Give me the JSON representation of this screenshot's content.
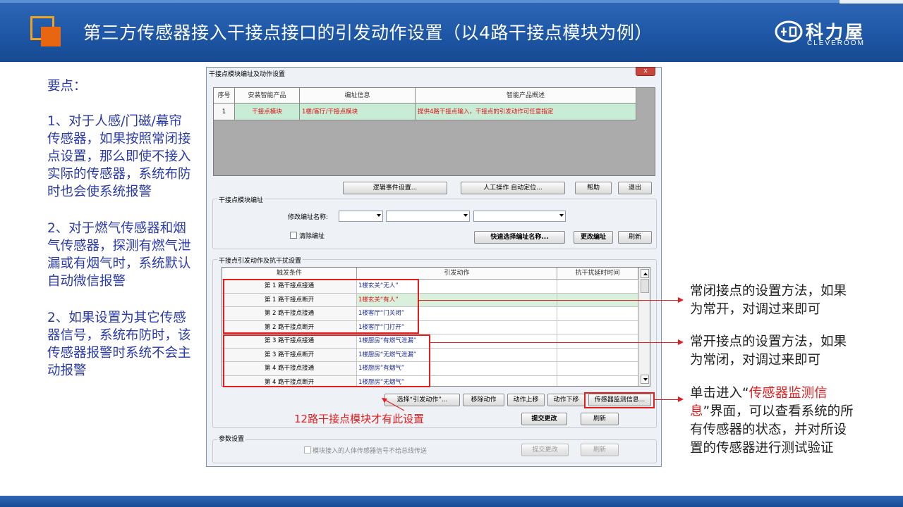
{
  "slide": {
    "title": "第三方传感器接入干接点接口的引发动作设置（以4路干接点模块为例）",
    "brand_cn": "科力屋",
    "brand_en": "CLEVEROOM",
    "colors": {
      "header_blue": "#1e57a6",
      "accent_orange": "#e8660f",
      "annotation_red": "#e21e1e",
      "note_blue": "#2a3aa8"
    }
  },
  "notes": {
    "heading": "要点：",
    "p1": "1、对于人感/门磁/幕帘传感器，如果按照常闭接点设置，那么即使不接入实际的传感器，系统布防时也会使系统报警",
    "p2": "2、对于燃气传感器和烟气传感器，探测有燃气泄漏或有烟气时，系统默认自动微信报警",
    "p3": "2、如果设置为其它传感器信号，系统布防时，该传感器报警时系统不会主动报警"
  },
  "dialog": {
    "title": "干接点模块编址及动作设置",
    "close_label": "x",
    "product_table": {
      "columns": [
        "序号",
        "安装智能产品",
        "编址信息",
        "智能产品概述"
      ],
      "rows": [
        [
          "1",
          "干接点模块",
          "1楼/客厅/干接点模块",
          "提供4路干接点输入，干接点的引发动作可任意指定"
        ]
      ]
    },
    "top_buttons": {
      "logic": "逻辑事件设置...",
      "manual": "人工操作  自动定位...",
      "help": "帮助",
      "exit": "退出"
    },
    "addr_section": {
      "label": "干接点模块编址",
      "rename_label": "修改编址名称:",
      "clear_label": "清除编址",
      "quick_select": "快速选择编址名称...",
      "change_addr": "更改编址",
      "refresh": "刷新"
    },
    "action_section": {
      "label": "干接点引发动作及抗干扰设置",
      "columns": [
        "触发条件",
        "引发动作",
        "抗干扰延时时间"
      ],
      "rows": [
        {
          "trigger": "第 1 路干接点接通",
          "action": "1楼玄关“无人”"
        },
        {
          "trigger": "第 1 路干接点断开",
          "action": "1楼玄关“有人”"
        },
        {
          "trigger": "第 2 路干接点接通",
          "action": "1楼客厅“门关闭”"
        },
        {
          "trigger": "第 2 路干接点断开",
          "action": "1楼客厅“门打开”"
        },
        {
          "trigger": "第 3 路干接点接通",
          "action": "1楼厨房“有燃气泄漏”"
        },
        {
          "trigger": "第 3 路干接点断开",
          "action": "1楼厨房“无燃气泄漏”"
        },
        {
          "trigger": "第 4 路干接点接通",
          "action": "1楼厨房“有烟气”"
        },
        {
          "trigger": "第 4 路干接点断开",
          "action": "1楼厨房“无烟气”"
        }
      ],
      "buttons": {
        "select_action": "选择“引发动作”...",
        "remove_action": "移除动作",
        "move_up": "动作上移",
        "move_down": "动作下移",
        "sensor_monitor": "传感器监测信息...",
        "submit": "提交更改",
        "refresh": "刷新"
      }
    },
    "param_section": {
      "label": "参数设置",
      "checkbox_label": "模块接入的人体传感器信号不给总线传送",
      "submit": "提交更改",
      "refresh": "刷新"
    }
  },
  "annotations": {
    "note_12": "12路干接点模块才有此设置",
    "nc": "常闭接点的设置方法，如果为常开，对调过来即可",
    "no": "常开接点的设置方法，如果为常闭，对调过来即可",
    "monitor_pre": "单击进入“",
    "monitor_hl": "传感器监测信息",
    "monitor_post": "”界面，可以查看系统的所有传感器的状态，并对所设置的传感器进行测试验证"
  }
}
